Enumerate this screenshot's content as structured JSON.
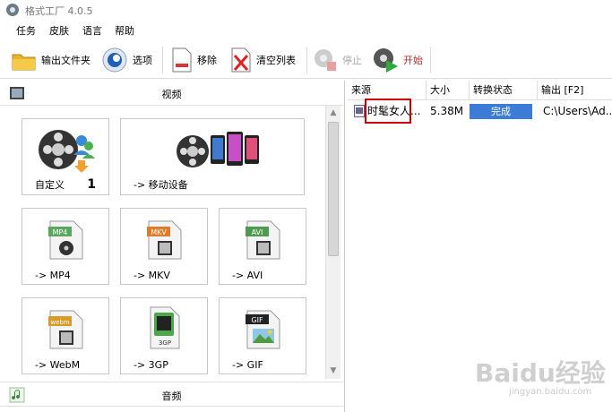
{
  "window": {
    "title": "格式工厂 4.0.5"
  },
  "menu": [
    "任务",
    "皮肤",
    "语言",
    "帮助"
  ],
  "toolbar": {
    "output_folder": "输出文件夹",
    "options": "选项",
    "remove": "移除",
    "clear_list": "清空列表",
    "stop": "停止",
    "start": "开始"
  },
  "categories": {
    "video": "视频",
    "audio": "音频"
  },
  "tiles": {
    "custom": {
      "label": "自定义",
      "count": "1"
    },
    "mobile": "-> 移动设备",
    "mp4": {
      "label": "-> MP4",
      "badge": "MP4"
    },
    "mkv": {
      "label": "-> MKV",
      "badge": "MKV"
    },
    "avi": {
      "label": "-> AVI",
      "badge": "AVI"
    },
    "webm": {
      "label": "-> WebM",
      "badge": "webm"
    },
    "3gp": {
      "label": "-> 3GP",
      "badge": "3GP"
    },
    "gif": {
      "label": "-> GIF",
      "badge": "GIF"
    }
  },
  "table": {
    "headers": [
      "来源",
      "大小",
      "转换状态",
      "输出 [F2]"
    ],
    "rows": [
      {
        "source": "时髦女人...",
        "size": "5.38M",
        "status": "完成",
        "output": "C:\\Users\\Ad..."
      }
    ]
  },
  "watermark": {
    "main": "Baidu经验",
    "sub": "jingyan.baidu.com"
  },
  "colors": {
    "status_done": "#3c7bd6",
    "highlight": "#cc0000"
  }
}
